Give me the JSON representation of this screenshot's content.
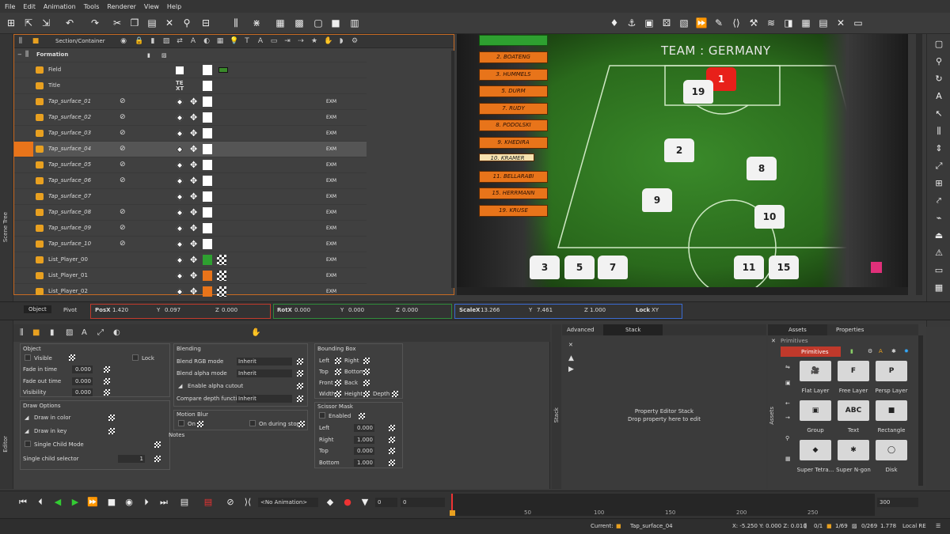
{
  "menu": [
    "File",
    "Edit",
    "Animation",
    "Tools",
    "Renderer",
    "View",
    "Help"
  ],
  "side_tabs": {
    "scene_tree": "Scene Tree",
    "editor": "Editor"
  },
  "scene": {
    "header": "Section/Container",
    "group": "Formation",
    "rows": [
      {
        "name": "Field",
        "exm": ""
      },
      {
        "name": "Title",
        "exm": ""
      },
      {
        "name": "Tap_surface_01",
        "exm": "EXM"
      },
      {
        "name": "Tap_surface_02",
        "exm": "EXM"
      },
      {
        "name": "Tap_surface_03",
        "exm": "EXM"
      },
      {
        "name": "Tap_surface_04",
        "exm": "EXM"
      },
      {
        "name": "Tap_surface_05",
        "exm": "EXM"
      },
      {
        "name": "Tap_surface_06",
        "exm": "EXM"
      },
      {
        "name": "Tap_surface_07",
        "exm": "EXM"
      },
      {
        "name": "Tap_surface_08",
        "exm": "EXM"
      },
      {
        "name": "Tap_surface_09",
        "exm": "EXM"
      },
      {
        "name": "Tap_surface_10",
        "exm": "EXM"
      },
      {
        "name": "List_Player_00",
        "exm": "EXM"
      },
      {
        "name": "List_Player_01",
        "exm": "EXM"
      },
      {
        "name": "List_Player_02",
        "exm": "EXM"
      }
    ],
    "title_text": "TE XT"
  },
  "viewport": {
    "team_title": "TEAM : GERMANY",
    "players": [
      "2. BOATENG",
      "3. HUMMELS",
      "5. DURM",
      "7. RUDY",
      "8. PODOLSKI",
      "9. KHEDIRA",
      "10. KRAMER",
      "11. BELLARABI",
      "15. HERRMANN",
      "19. KRUSE"
    ],
    "numbers": [
      "1",
      "19",
      "2",
      "8",
      "9",
      "10",
      "3",
      "5",
      "7",
      "11",
      "15"
    ]
  },
  "transform": {
    "tabs": [
      "Object",
      "Pivot"
    ],
    "pos": {
      "label": "PosX",
      "x": "1.420",
      "y_label": "Y",
      "y": "0.097",
      "z_label": "Z",
      "z": "0.000"
    },
    "rot": {
      "label": "RotX",
      "x": "0.000",
      "y_label": "Y",
      "y": "0.000",
      "z_label": "Z",
      "z": "0.000"
    },
    "scale": {
      "label": "ScaleX",
      "x": "13.266",
      "y_label": "Y",
      "y": "7.461",
      "z_label": "Z",
      "z": "1.000",
      "lock_label": "Lock",
      "lock": "XY"
    }
  },
  "editor": {
    "object": {
      "title": "Object",
      "visible": "Visible",
      "lock": "Lock",
      "fade_in": "Fade in time",
      "fade_in_v": "0.000",
      "fade_out": "Fade out time",
      "fade_out_v": "0.000",
      "visibility": "Visibility",
      "visibility_v": "0.000"
    },
    "draw": {
      "title": "Draw Options",
      "color": "Draw in color",
      "key": "Draw in key",
      "single": "Single Child Mode",
      "selector": "Single child selector",
      "selector_v": "1"
    },
    "blending": {
      "title": "Blending",
      "rgb": "Blend RGB mode",
      "rgb_v": "Inherit",
      "alpha": "Blend alpha mode",
      "alpha_v": "Inherit",
      "cutout": "Enable alpha cutout",
      "depth": "Compare depth function",
      "depth_v": "Inherit"
    },
    "motion": {
      "title": "Motion Blur",
      "on": "On",
      "stop": "On during stop",
      "notes": "Notes"
    },
    "bbox": {
      "title": "Bounding Box",
      "left": "Left",
      "right": "Right",
      "top": "Top",
      "bottom": "Bottom",
      "front": "Front",
      "back": "Back",
      "width": "Width",
      "height": "Height",
      "depth": "Depth"
    },
    "scissor": {
      "title": "Scissor Mask",
      "enabled": "Enabled",
      "left": "Left",
      "left_v": "0.000",
      "right": "Right",
      "right_v": "1.000",
      "top": "Top",
      "top_v": "0.000",
      "bottom": "Bottom",
      "bottom_v": "1.000"
    }
  },
  "stack": {
    "tabs": [
      "Advanced",
      "Stack"
    ],
    "title": "Property Editor Stack",
    "hint": "Drop property here to edit",
    "side": "Stack"
  },
  "assets": {
    "tabs": [
      "Assets",
      "Properties"
    ],
    "primitives_label": "Primitives",
    "tab": "Primitives",
    "side": "Assets",
    "items": [
      {
        "label": "Flat Layer",
        "glyph": "🎥"
      },
      {
        "label": "Free Layer",
        "glyph": "F"
      },
      {
        "label": "Persp Layer",
        "glyph": "P"
      },
      {
        "label": "Group",
        "glyph": "▣"
      },
      {
        "label": "Text",
        "glyph": "ABC"
      },
      {
        "label": "Rectangle",
        "glyph": "■"
      },
      {
        "label": "Super Tetra...",
        "glyph": "◆"
      },
      {
        "label": "Super N-gon",
        "glyph": "✱"
      },
      {
        "label": "Disk",
        "glyph": "◯"
      }
    ]
  },
  "timeline": {
    "animation": "<No Animation>",
    "v1": "0",
    "v2": "0",
    "end": "300",
    "ticks": [
      "50",
      "100",
      "150",
      "200",
      "250"
    ]
  },
  "status": {
    "current_label": "Current:",
    "current": "Tap_surface_04",
    "coords": "X: -5.250 Y: 0.000 Z: 0.010",
    "count1": "0/1",
    "count2": "1/69",
    "count3": "0/269",
    "zoom": "1.778",
    "mode": "Local RE"
  }
}
